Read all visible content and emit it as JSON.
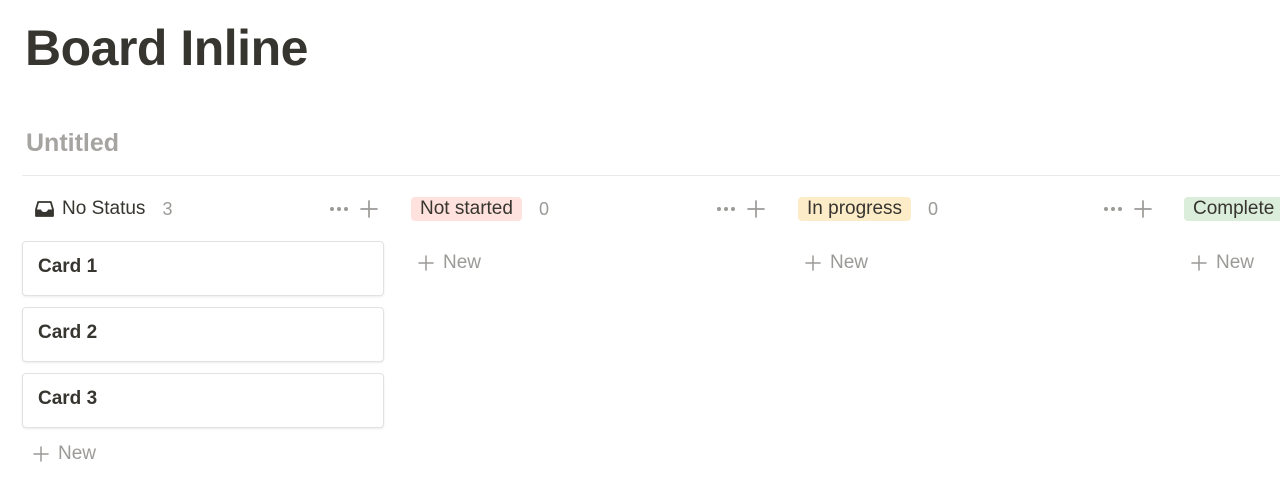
{
  "page": {
    "title": "Board Inline"
  },
  "view": {
    "title": "Untitled"
  },
  "board": {
    "new_label": "New",
    "columns": [
      {
        "name": "No Status",
        "count": "3",
        "style": "plain",
        "icon": "inbox-icon",
        "color": "",
        "cards": [
          "Card 1",
          "Card 2",
          "Card 3"
        ]
      },
      {
        "name": "Not started",
        "count": "0",
        "style": "pill",
        "color": "#ffe2dd",
        "cards": []
      },
      {
        "name": "In progress",
        "count": "0",
        "style": "pill",
        "color": "#fdecc8",
        "cards": []
      },
      {
        "name": "Complete",
        "count": "",
        "style": "pill",
        "color": "#dbeddb",
        "cards": []
      }
    ]
  },
  "colors": {
    "text": "#37352f",
    "muted": "#9b9a97",
    "placeholder_title": "#a5a4a1",
    "divider": "#e9e9e7"
  }
}
